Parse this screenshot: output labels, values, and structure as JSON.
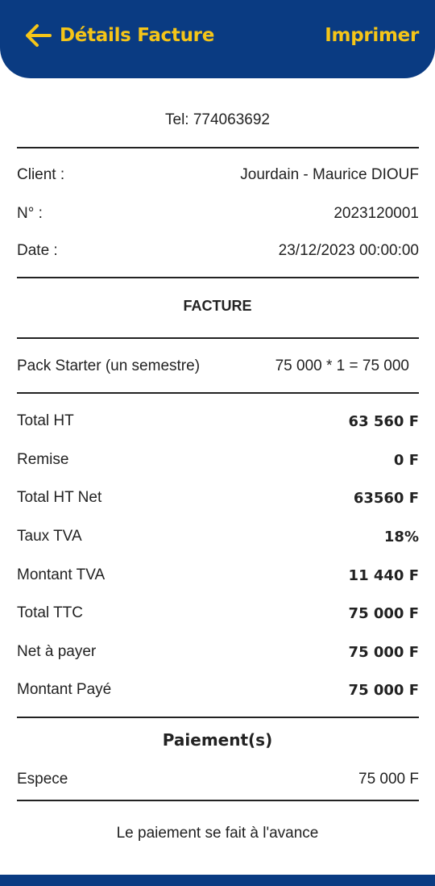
{
  "header": {
    "title": "Détails Facture",
    "print_label": "Imprimer",
    "back_icon": "arrow-left-icon",
    "accent_color": "#f5c518",
    "brand_color": "#0a3b82"
  },
  "company": {
    "tel": "Tel: 774063692"
  },
  "info": {
    "client_label": "Client :",
    "client_value": "Jourdain - Maurice DIOUF",
    "number_label": "N° :",
    "number_value": "2023120001",
    "date_label": "Date :",
    "date_value": "23/12/2023 00:00:00"
  },
  "invoice": {
    "section_title": "FACTURE",
    "items": [
      {
        "name": "Pack Starter (un semestre)",
        "calc": "75 000 * 1 = 75 000"
      }
    ]
  },
  "totals": [
    {
      "label": "Total HT",
      "value": "63 560 F"
    },
    {
      "label": "Remise",
      "value": "0 F"
    },
    {
      "label": "Total HT Net",
      "value": "63560 F"
    },
    {
      "label": "Taux TVA",
      "value": "18%"
    },
    {
      "label": "Montant TVA",
      "value": "11 440 F"
    },
    {
      "label": "Total TTC",
      "value": "75 000 F"
    },
    {
      "label": "Net à payer",
      "value": "75 000 F"
    },
    {
      "label": "Montant Payé",
      "value": "75 000 F"
    }
  ],
  "payments": {
    "section_title": "Paiement(s)",
    "items": [
      {
        "method": "Espece",
        "amount": "75 000 F"
      }
    ]
  },
  "footer": {
    "note": "Le paiement se fait à l'avance"
  }
}
